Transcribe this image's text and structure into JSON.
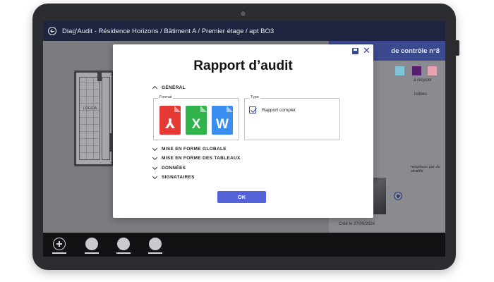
{
  "topbar": {
    "breadcrumb": "Diag'Audit - Résidence Horizons / Bâtiment A / Premier étage / apt BO3"
  },
  "background": {
    "plan_room_label": "LOGGIA",
    "right_panel": {
      "header_title": "de contrôle n°8",
      "swatch_colors": [
        "#7ec3d6",
        "#5a1d6e",
        "#e8a2b0"
      ],
      "recycle_note": "à recycler",
      "lisibles_note": "lisibles",
      "replace_note": "remplacer par du stratifié",
      "created_date": "Créé le 27/09/2024"
    }
  },
  "modal": {
    "title": "Rapport d’audit",
    "sections": {
      "general": "GÉNÉRAL",
      "format_label": "Format",
      "type_label": "Type",
      "type_option": "Rapport complet",
      "type_checked": true,
      "collapsed": [
        "MISE EN FORME GLOBALE",
        "MISE EN FORME DES TABLEAUX",
        "DONNÉES",
        "SIGNATAIRES"
      ]
    },
    "formats": [
      {
        "name": "pdf-icon",
        "color": "#e53935",
        "glyph": "⅄"
      },
      {
        "name": "excel-icon",
        "color": "#2fb34a",
        "glyph": "X"
      },
      {
        "name": "word-icon",
        "color": "#3a8ef0",
        "glyph": "W"
      }
    ],
    "ok_label": "OK"
  },
  "bottombar": {
    "items": [
      "add-icon",
      "tool-1",
      "tool-2",
      "tool-3"
    ]
  },
  "colors": {
    "brand": "#3b4a8f",
    "ok_button": "#5561d6",
    "topbar": "#1f2540"
  }
}
